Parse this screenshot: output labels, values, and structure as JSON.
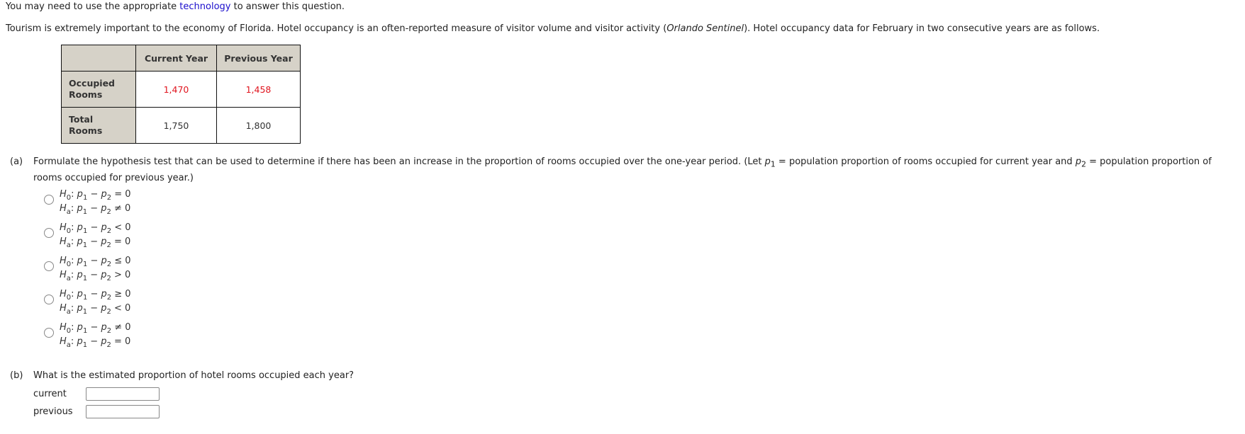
{
  "intro": {
    "line1_before": "You may need to use the appropriate ",
    "link": "technology",
    "line1_after": " to answer this question.",
    "line2_before": "Tourism is extremely important to the economy of Florida. Hotel occupancy is an often-reported measure of visitor volume and visitor activity (",
    "line2_source": "Orlando Sentinel",
    "line2_after": "). Hotel occupancy data for February in two consecutive years are as follows."
  },
  "table": {
    "headers": [
      "",
      "Current Year",
      "Previous Year"
    ],
    "rows": [
      {
        "label_line1": "Occupied",
        "label_line2": "Rooms",
        "current": "1,470",
        "previous": "1,458"
      },
      {
        "label_line1": "Total",
        "label_line2": "Rooms",
        "current": "1,750",
        "previous": "1,800"
      }
    ]
  },
  "partA": {
    "label": "(a)",
    "text1": "Formulate the hypothesis test that can be used to determine if there has been an increase in the proportion of rooms occupied over the one-year period. (Let ",
    "p1": "p",
    "p1_sub": "1",
    "text2": " = population proportion of rooms occupied for current year and ",
    "p2": "p",
    "p2_sub": "2",
    "text3": " = population proportion of",
    "text4": "rooms occupied for previous year.)",
    "options": [
      {
        "h0_op": "=",
        "ha_op": "≠"
      },
      {
        "h0_op": "<",
        "ha_op": "="
      },
      {
        "h0_op": "≤",
        "ha_op": ">"
      },
      {
        "h0_op": "≥",
        "ha_op": "<"
      },
      {
        "h0_op": "≠",
        "ha_op": "="
      }
    ],
    "H": "H",
    "sub0": "0",
    "suba": "a",
    "expr_left": ": ",
    "p": "p",
    "minus": " − ",
    "zero": "0"
  },
  "partB": {
    "label": "(b)",
    "question": "What is the estimated proportion of hotel rooms occupied each year?",
    "fields": [
      {
        "label": "current",
        "value": ""
      },
      {
        "label": "previous",
        "value": ""
      }
    ]
  }
}
